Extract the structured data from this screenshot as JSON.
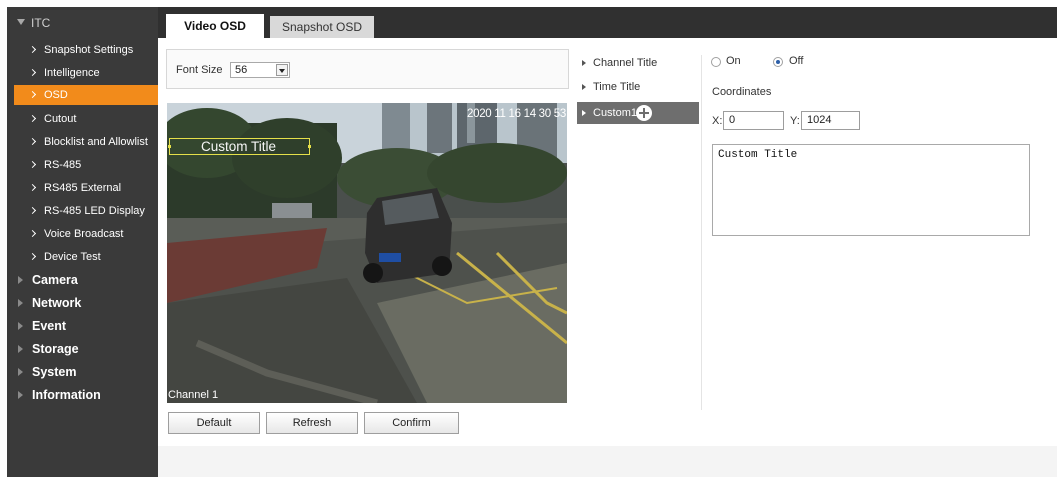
{
  "sidebar": {
    "header": "ITC",
    "subitems": [
      {
        "label": "Snapshot Settings"
      },
      {
        "label": "Intelligence"
      },
      {
        "label": "OSD",
        "active": true
      },
      {
        "label": "Cutout"
      },
      {
        "label": "Blocklist and Allowlist"
      },
      {
        "label": "RS-485"
      },
      {
        "label": "RS485 External"
      },
      {
        "label": "RS-485 LED Display"
      },
      {
        "label": "Voice Broadcast"
      },
      {
        "label": "Device Test"
      }
    ],
    "categories": [
      {
        "label": "Camera"
      },
      {
        "label": "Network"
      },
      {
        "label": "Event"
      },
      {
        "label": "Storage"
      },
      {
        "label": "System"
      },
      {
        "label": "Information"
      }
    ]
  },
  "tabs": [
    {
      "label": "Video OSD",
      "active": true
    },
    {
      "label": "Snapshot OSD",
      "active": false
    }
  ],
  "font_size": {
    "label": "Font Size",
    "value": "56"
  },
  "video": {
    "timestamp": "2020 11 16 14 30 53",
    "custom_title": "Custom Title",
    "channel_label": "Channel 1"
  },
  "buttons": {
    "default": "Default",
    "refresh": "Refresh",
    "confirm": "Confirm"
  },
  "title_list": [
    {
      "label": "Channel Title",
      "selected": false
    },
    {
      "label": "Time Title",
      "selected": false
    },
    {
      "label": "Custom1",
      "selected": true
    }
  ],
  "settings": {
    "on_label": "On",
    "off_label": "Off",
    "selected": "Off",
    "coordinates_label": "Coordinates",
    "x_label": "X:",
    "x_value": "0",
    "y_label": "Y:",
    "y_value": "1024",
    "title_text": "Custom Title"
  },
  "colors": {
    "sidebar_bg": "#3a3a3a",
    "active_item": "#f28b1b",
    "selected_list_item": "#6e6e6e"
  }
}
